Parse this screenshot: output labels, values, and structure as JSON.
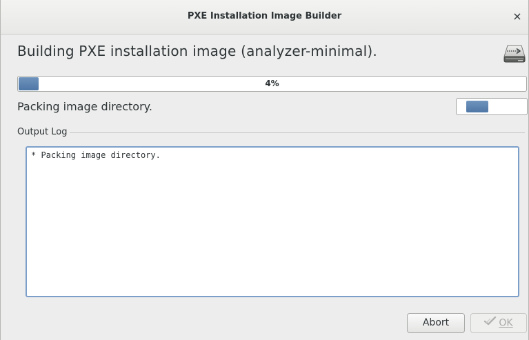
{
  "window": {
    "title": "PXE Installation Image Builder",
    "close_glyph": "×"
  },
  "heading": "Building PXE installation image (analyzer-minimal).",
  "icon": "drive-export-icon",
  "progress": {
    "value": 0.04,
    "label": "4%",
    "accent_color": "#5a80ae"
  },
  "status_text": "Packing image directory.",
  "output_log": {
    "label": "Output Log",
    "text": "* Packing image directory."
  },
  "buttons": {
    "abort_label": "Abort",
    "ok_label": "OK",
    "ok_enabled": false,
    "ok_icon": "checkmark-icon"
  }
}
